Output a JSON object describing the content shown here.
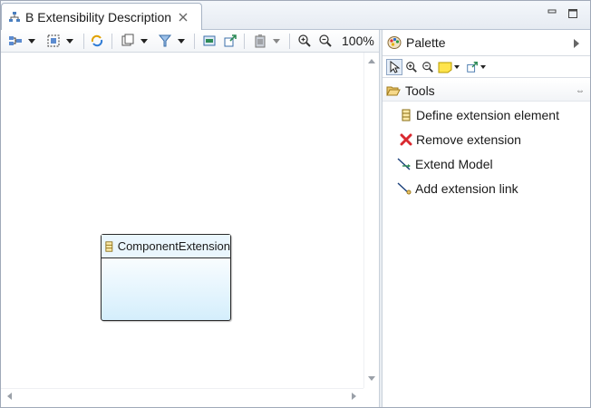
{
  "editor": {
    "tab_title": "B Extensibility Description",
    "zoom_level": "100%"
  },
  "diagram": {
    "node_title": "ComponentExtension"
  },
  "palette": {
    "title": "Palette",
    "drawer_label": "Tools",
    "entries": [
      {
        "label": "Define extension element",
        "icon": "extension-element-icon"
      },
      {
        "label": "Remove extension",
        "icon": "remove-x-icon"
      },
      {
        "label": "Extend Model",
        "icon": "extend-model-icon"
      },
      {
        "label": "Add extension link",
        "icon": "extension-link-icon"
      }
    ]
  },
  "colors": {
    "node_fill": "#d4eefc",
    "remove_icon": "#d9292f",
    "tab_border": "#a7b3c4"
  }
}
